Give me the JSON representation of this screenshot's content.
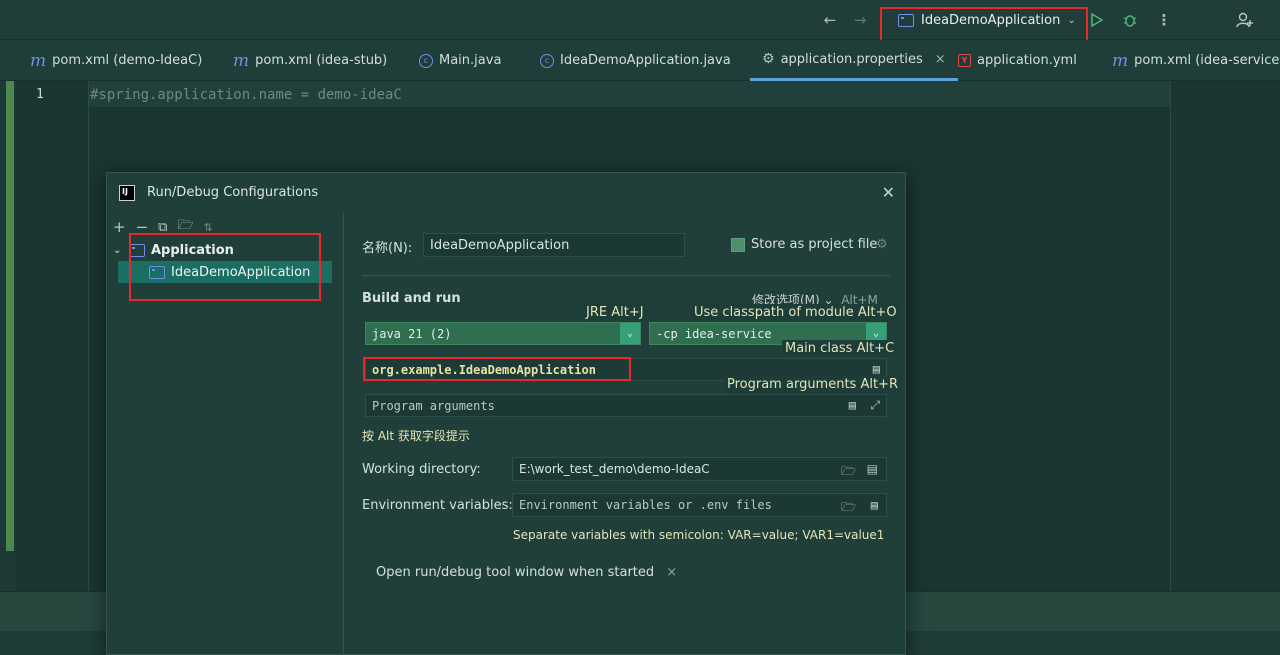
{
  "toolbar": {
    "run_config_label": "IdeaDemoApplication",
    "icons": [
      "back-arrow",
      "forward-arrow",
      "run",
      "debug",
      "more",
      "add-user"
    ]
  },
  "tabs": [
    {
      "label": "pom.xml (demo-IdeaC)",
      "icon": "maven-m"
    },
    {
      "label": "pom.xml (idea-stub)",
      "icon": "maven-m"
    },
    {
      "label": "Main.java",
      "icon": "class-c"
    },
    {
      "label": "IdeaDemoApplication.java",
      "icon": "class-c"
    },
    {
      "label": "application.properties",
      "icon": "gear",
      "active": true
    },
    {
      "label": "application.yml",
      "icon": "yaml"
    },
    {
      "label": "pom.xml (idea-service)",
      "icon": "maven-m"
    }
  ],
  "editor": {
    "line_number": "1",
    "code": "#spring.application.name = demo-ideaC"
  },
  "dialog": {
    "title": "Run/Debug Configurations",
    "tree": {
      "parent": "Application",
      "child": "IdeaDemoApplication"
    },
    "name_label": "名称(N):",
    "name_value": "IdeaDemoApplication",
    "store_label": "Store as project file",
    "build_run_label": "Build and run",
    "modify_options": "修改选项(M)",
    "modify_shortcut": "Alt+M",
    "jre_hint": "JRE Alt+J",
    "classpath_hint": "Use classpath of module Alt+O",
    "jre_value": "java 21 (2)",
    "cp_value": "-cp idea-service",
    "main_class_hint": "Main class Alt+C",
    "main_class_value": "org.example.IdeaDemoApplication",
    "program_args_hint": "Program arguments Alt+R",
    "program_args_placeholder": "Program arguments",
    "alt_hint": "按 Alt 获取字段提示",
    "working_dir_label": "Working directory:",
    "working_dir_value": "E:\\work_test_demo\\demo-IdeaC",
    "env_label": "Environment variables:",
    "env_placeholder": "Environment variables or .env files",
    "env_hint": "Separate variables with semicolon: VAR=value; VAR1=value1",
    "open_tool_window": "Open run/debug tool window when started"
  }
}
